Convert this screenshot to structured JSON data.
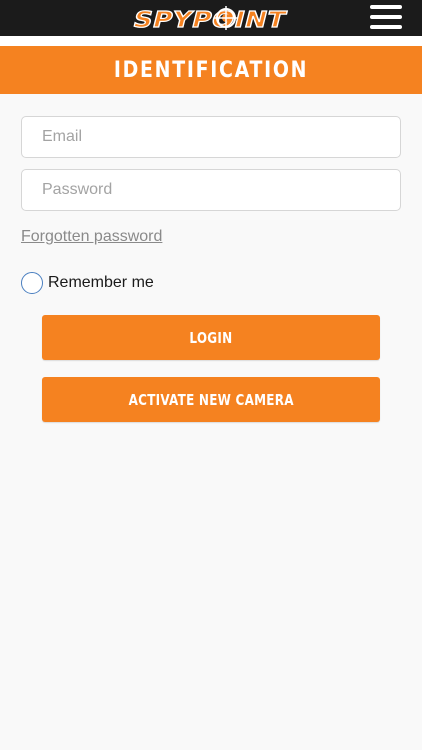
{
  "header": {
    "logo_text": "SPYPOINT",
    "logo_icon": "target-crosshair-icon",
    "menu_icon": "hamburger-menu-icon"
  },
  "page": {
    "title": "IDENTIFICATION"
  },
  "form": {
    "email_placeholder": "Email",
    "email_value": "",
    "password_placeholder": "Password",
    "password_value": "",
    "forgot_label": "Forgotten password",
    "remember_label": "Remember me",
    "remember_checked": false
  },
  "buttons": {
    "login_label": "LOGIN",
    "activate_label": "ACTIVATE NEW CAMERA"
  },
  "colors": {
    "accent": "#f58220",
    "header_bg": "#1b1b1b",
    "page_bg": "#f9f9f9",
    "radio_border": "#4a7fc0",
    "link_gray": "#8a8a8a"
  }
}
